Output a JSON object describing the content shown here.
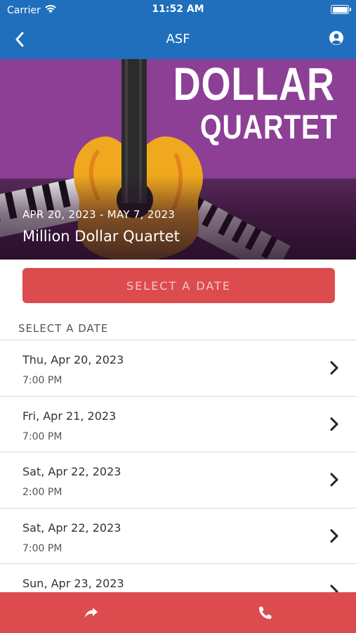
{
  "status_bar": {
    "carrier": "Carrier",
    "time": "11:52 AM"
  },
  "nav": {
    "title": "ASF",
    "back_icon": "chevron-left-icon",
    "account_icon": "user-circle-icon"
  },
  "hero": {
    "poster_line1": "DOLLAR",
    "poster_line2": "QUARTET",
    "dates": "APR 20, 2023 - MAY 7, 2023",
    "name": "Million Dollar Quartet"
  },
  "select_button": {
    "label": "SELECT A DATE"
  },
  "section_label": "SELECT A DATE",
  "performances": [
    {
      "date": "Thu, Apr 20, 2023",
      "time": "7:00 PM"
    },
    {
      "date": "Fri, Apr 21, 2023",
      "time": "7:00 PM"
    },
    {
      "date": "Sat, Apr 22, 2023",
      "time": "2:00 PM"
    },
    {
      "date": "Sat, Apr 22, 2023",
      "time": "7:00 PM"
    },
    {
      "date": "Sun, Apr 23, 2023",
      "time": ""
    }
  ],
  "bottom_bar": {
    "share_icon": "share-arrow-icon",
    "phone_icon": "phone-icon"
  },
  "colors": {
    "nav_blue": "#1f6fbd",
    "accent_red": "#dc4c4f",
    "hero_purple": "#8d3f96"
  }
}
